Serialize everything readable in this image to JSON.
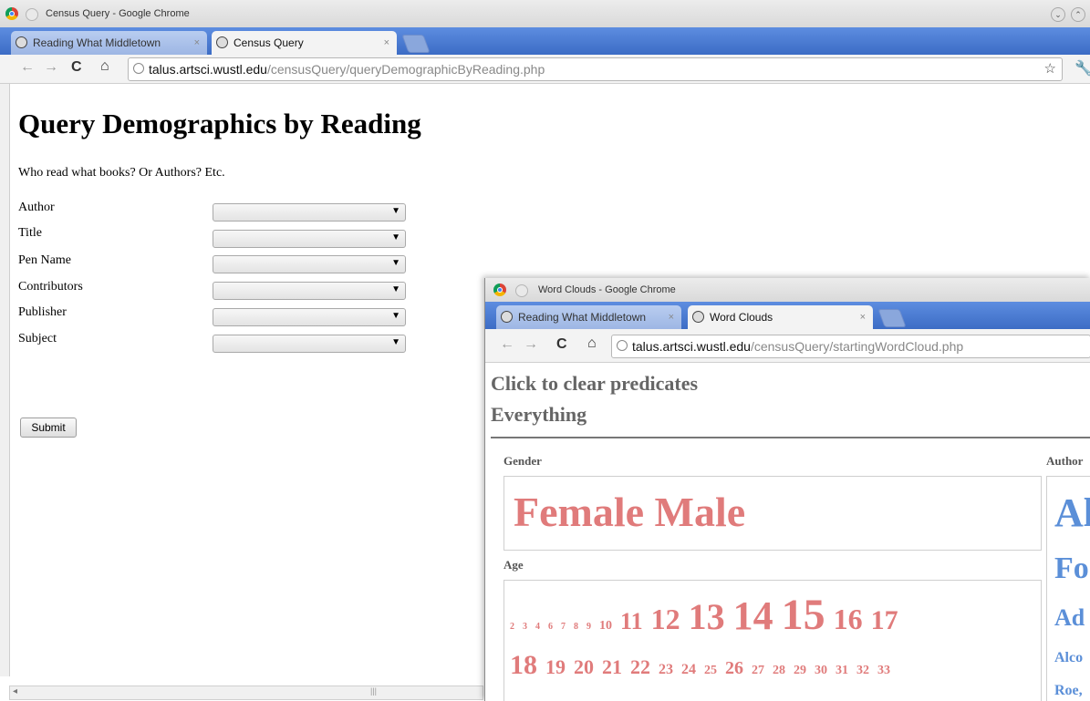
{
  "window1": {
    "os_title": "Census Query - Google Chrome",
    "tabs": [
      {
        "label": "Reading What Middletown",
        "active": false
      },
      {
        "label": "Census Query",
        "active": true
      }
    ],
    "url_host": "talus.artsci.wustl.edu",
    "url_path": "/censusQuery/queryDemographicByReading.php",
    "page": {
      "heading": "Query Demographics by Reading",
      "intro": "Who read what books? Or Authors? Etc.",
      "fields": [
        {
          "label": "Author",
          "value": ""
        },
        {
          "label": "Title",
          "value": ""
        },
        {
          "label": "Pen Name",
          "value": ""
        },
        {
          "label": "Contributors",
          "value": ""
        },
        {
          "label": "Publisher",
          "value": ""
        },
        {
          "label": "Subject",
          "value": ""
        }
      ],
      "submit_label": "Submit"
    }
  },
  "window2": {
    "os_title": "Word Clouds - Google Chrome",
    "tabs": [
      {
        "label": "Reading What Middletown",
        "active": false
      },
      {
        "label": "Word Clouds",
        "active": true
      }
    ],
    "url_host": "talus.artsci.wustl.edu",
    "url_path": "/censusQuery/startingWordCloud.php",
    "page": {
      "clear_predicates": "Click to clear predicates",
      "everything": "Everything",
      "gender_label": "Gender",
      "gender_words": "Female Male",
      "age_label": "Age",
      "ages_row1": [
        "2",
        "3",
        "4",
        "6",
        "7",
        "8",
        "9",
        "10",
        "11",
        "12",
        "13",
        "14",
        "15",
        "16",
        "17"
      ],
      "ages_row2": [
        "18",
        "19",
        "20",
        "21",
        "22",
        "23",
        "24",
        "25",
        "26",
        "27",
        "28",
        "29",
        "30",
        "31",
        "32",
        "33"
      ],
      "author_label": "Author",
      "author_words": [
        "Al",
        "Fo",
        "Ad",
        "Alco",
        "Roe,"
      ]
    }
  },
  "colors": {
    "cloud_red": "#e07b7b",
    "cloud_blue": "#5b8fd8",
    "tab_strip": "#4a7bd3"
  },
  "icons": [
    "chrome-logo",
    "globe-icon",
    "back-arrow-icon",
    "forward-arrow-icon",
    "reload-icon",
    "home-icon",
    "star-icon",
    "wrench-icon"
  ]
}
